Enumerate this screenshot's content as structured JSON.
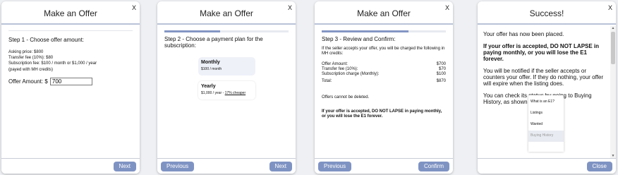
{
  "panels": {
    "offer_amount": {
      "title": "Make an Offer",
      "close": "X",
      "step": "Step 1 - Choose offer amount:",
      "asking_price": "Asking price: $800",
      "transfer_fee": "Transfer fee (10%): $80",
      "subscription_fee": "Subscription fee: $100 / month or $1,000 / year",
      "payed_note": "(payed with MH credits)",
      "offer_label": "Offer Amount: $",
      "offer_value": "700",
      "next": "Next"
    },
    "payment_plan": {
      "title": "Make an Offer",
      "close": "X",
      "progress": 0.45,
      "step": "Step 2 - Choose a payment plan for the subscription:",
      "monthly_name": "Monthly",
      "monthly_price": "$100 / month",
      "yearly_name": "Yearly",
      "yearly_price": "$1,000 / year - ",
      "yearly_discount": "17% cheaper",
      "previous": "Previous",
      "next": "Next"
    },
    "review": {
      "title": "Make an Offer",
      "close": "X",
      "progress": 0.7,
      "step": "Step 3 - Review and Confirm:",
      "description": "If the seller accepts your offer, you will be charged the following in MH credits:",
      "rows": [
        {
          "label": "Offer Amount:",
          "value": "$700"
        },
        {
          "label": "Transfer fee (10%):",
          "value": "$70"
        },
        {
          "label": "Subscription charge (Monthly):",
          "value": "$100"
        }
      ],
      "total_label": "Total:",
      "total_value": "$870",
      "no_delete": "Offers cannot be deleted.",
      "warning": "If your offer is accepted, DO NOT LAPSE in paying monthly, or you will lose the E1 forever.",
      "previous": "Previous",
      "confirm": "Confirm"
    },
    "success": {
      "title": "Success!",
      "close": "X",
      "placed": "Your offer has now been placed.",
      "warning": "If your offer is accepted, DO NOT LAPSE in paying monthly, or you will lose the E1 forever.",
      "notify": "You will be notified if the seller accepts or counters your offer. If they do nothing, your offer will expire when the listing does.",
      "check": "You can check its status by going to Buying History, as shown below:",
      "menu_items": [
        "What is an E1?",
        "Listings",
        "Wanted",
        "Buying History"
      ],
      "close_button": "Close"
    }
  }
}
